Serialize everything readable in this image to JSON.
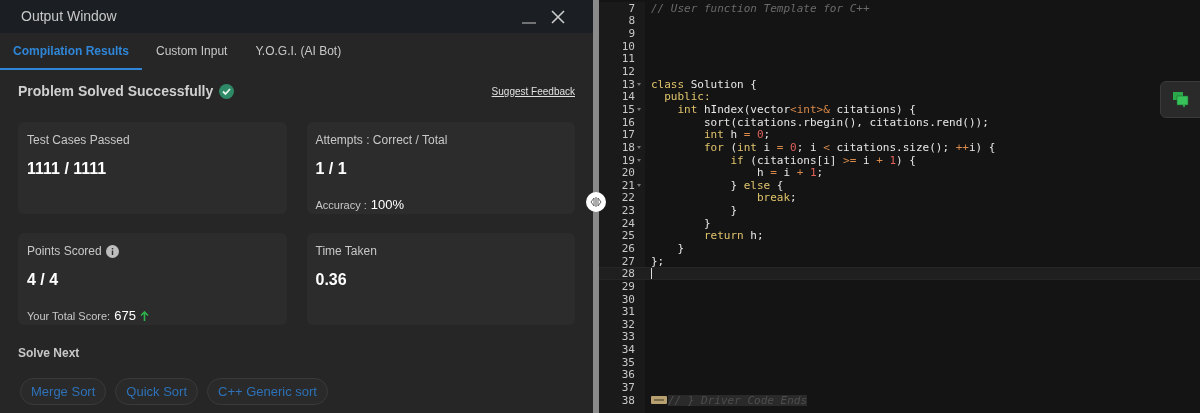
{
  "output_window": {
    "title": "Output Window",
    "tabs": [
      {
        "label": "Compilation Results",
        "selected": true
      },
      {
        "label": "Custom Input",
        "selected": false
      },
      {
        "label": "Y.O.G.I. (AI Bot)",
        "selected": false
      }
    ],
    "status": {
      "text": "Problem Solved Successfully",
      "success": true
    },
    "feedback_link": "Suggest Feedback",
    "cards": [
      {
        "label": "Test Cases Passed",
        "value": "1111 / 1111"
      },
      {
        "label": "Attempts : Correct / Total",
        "value": "1 / 1",
        "extra_label": "Accuracy :",
        "extra_value": "100%"
      },
      {
        "label": "Points Scored",
        "info": true,
        "value": "4 / 4",
        "extra_label": "Your Total Score:",
        "extra_value": "675",
        "trend_up": true
      },
      {
        "label": "Time Taken",
        "value": "0.36"
      }
    ],
    "solve_next": {
      "title": "Solve Next",
      "items": [
        "Merge Sort",
        "Quick Sort",
        "C++ Generic sort"
      ]
    }
  },
  "editor": {
    "lines": [
      {
        "number": "7",
        "tokens": [
          {
            "text": "// User function Template for C++",
            "kind": "comment"
          }
        ]
      },
      {
        "number": "8"
      },
      {
        "number": "9"
      },
      {
        "number": "10"
      },
      {
        "number": "11"
      },
      {
        "number": "12"
      },
      {
        "number": "13",
        "fold": true,
        "tokens": [
          {
            "text": "class",
            "kind": "keyword"
          },
          {
            "text": " Solution {",
            "kind": "plain"
          }
        ]
      },
      {
        "number": "14",
        "tokens": [
          {
            "text": "  public:",
            "kind": "keyword"
          }
        ]
      },
      {
        "number": "15",
        "fold": true,
        "tokens": [
          {
            "text": "    int",
            "kind": "keyword"
          },
          {
            "text": " hIndex(vector",
            "kind": "plain"
          },
          {
            "text": "<int>&",
            "kind": "operator"
          },
          {
            "text": " citations) {",
            "kind": "plain"
          }
        ]
      },
      {
        "number": "16",
        "tokens": [
          {
            "text": "        sort(citations.rbegin(), citations.rend());",
            "kind": "plain"
          }
        ]
      },
      {
        "number": "17",
        "tokens": [
          {
            "text": "        int",
            "kind": "keyword"
          },
          {
            "text": " h ",
            "kind": "plain"
          },
          {
            "text": "=",
            "kind": "operator"
          },
          {
            "text": " 0",
            "kind": "number"
          },
          {
            "text": ";",
            "kind": "plain"
          }
        ]
      },
      {
        "number": "18",
        "fold": true,
        "tokens": [
          {
            "text": "        for",
            "kind": "keyword"
          },
          {
            "text": " (",
            "kind": "plain"
          },
          {
            "text": "int",
            "kind": "keyword"
          },
          {
            "text": " i ",
            "kind": "plain"
          },
          {
            "text": "=",
            "kind": "operator"
          },
          {
            "text": " 0",
            "kind": "number"
          },
          {
            "text": "; i ",
            "kind": "plain"
          },
          {
            "text": "<",
            "kind": "operator"
          },
          {
            "text": " citations.size(); ",
            "kind": "plain"
          },
          {
            "text": "++",
            "kind": "operator"
          },
          {
            "text": "i) {",
            "kind": "plain"
          }
        ]
      },
      {
        "number": "19",
        "fold": true,
        "tokens": [
          {
            "text": "            if",
            "kind": "keyword"
          },
          {
            "text": " (citations[i] ",
            "kind": "plain"
          },
          {
            "text": ">=",
            "kind": "operator"
          },
          {
            "text": " i ",
            "kind": "plain"
          },
          {
            "text": "+",
            "kind": "operator"
          },
          {
            "text": " 1",
            "kind": "number"
          },
          {
            "text": ") {",
            "kind": "plain"
          }
        ]
      },
      {
        "number": "20",
        "tokens": [
          {
            "text": "                h ",
            "kind": "plain"
          },
          {
            "text": "=",
            "kind": "operator"
          },
          {
            "text": " i ",
            "kind": "plain"
          },
          {
            "text": "+",
            "kind": "operator"
          },
          {
            "text": " 1",
            "kind": "number"
          },
          {
            "text": ";",
            "kind": "plain"
          }
        ]
      },
      {
        "number": "21",
        "fold": true,
        "tokens": [
          {
            "text": "            } ",
            "kind": "plain"
          },
          {
            "text": "else",
            "kind": "keyword"
          },
          {
            "text": " {",
            "kind": "plain"
          }
        ]
      },
      {
        "number": "22",
        "tokens": [
          {
            "text": "                break",
            "kind": "keyword"
          },
          {
            "text": ";",
            "kind": "plain"
          }
        ]
      },
      {
        "number": "23",
        "tokens": [
          {
            "text": "            }",
            "kind": "plain"
          }
        ]
      },
      {
        "number": "24",
        "tokens": [
          {
            "text": "        }",
            "kind": "plain"
          }
        ]
      },
      {
        "number": "25",
        "tokens": [
          {
            "text": "        return",
            "kind": "keyword"
          },
          {
            "text": " h;",
            "kind": "plain"
          }
        ]
      },
      {
        "number": "26",
        "tokens": [
          {
            "text": "    }",
            "kind": "plain"
          }
        ]
      },
      {
        "number": "27",
        "tokens": [
          {
            "text": "};",
            "kind": "plain"
          }
        ]
      },
      {
        "number": "28",
        "current": true
      },
      {
        "number": "29"
      },
      {
        "number": "30"
      },
      {
        "number": "31"
      },
      {
        "number": "32"
      },
      {
        "number": "33"
      },
      {
        "number": "34"
      },
      {
        "number": "35"
      },
      {
        "number": "36"
      },
      {
        "number": "37"
      },
      {
        "number": "38",
        "folded": true,
        "tokens": [
          {
            "text": "// } Driver Code Ends",
            "kind": "comment"
          }
        ]
      }
    ]
  }
}
